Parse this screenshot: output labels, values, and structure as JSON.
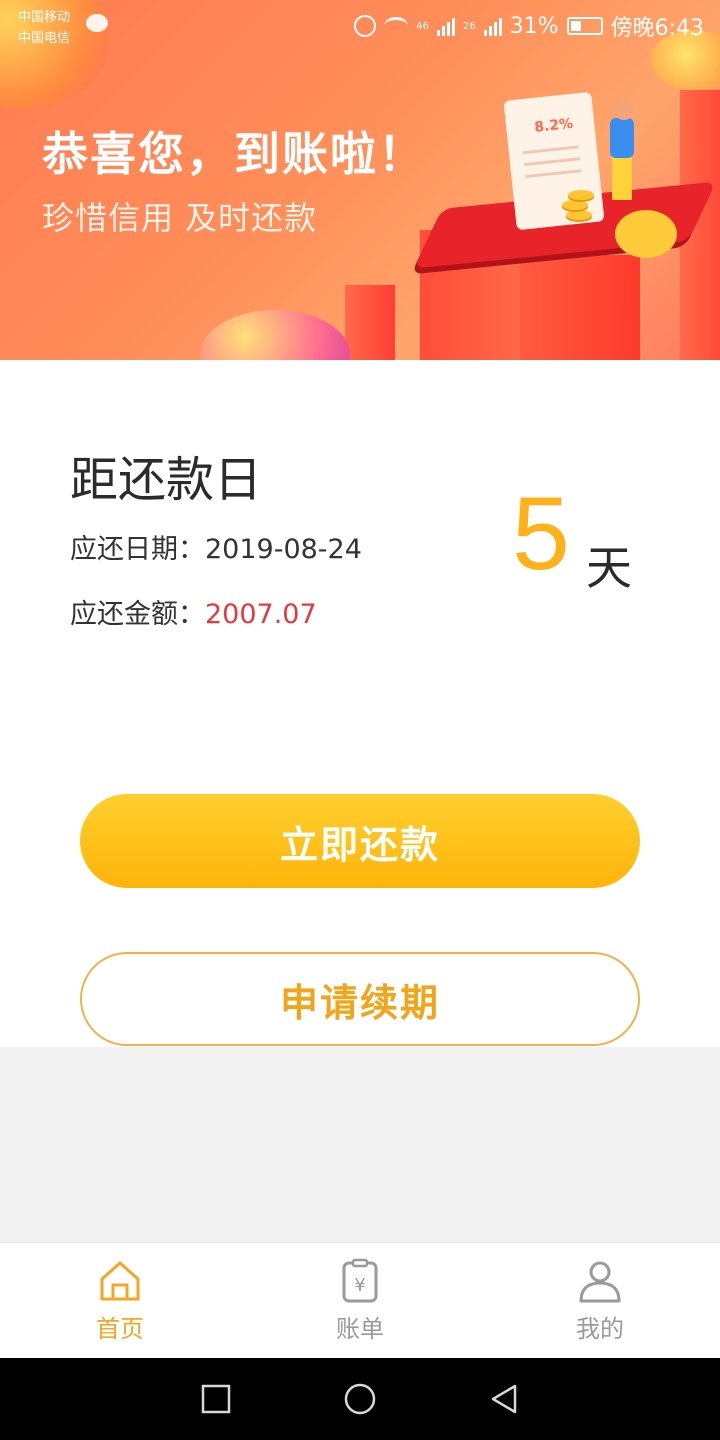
{
  "status_bar": {
    "carrier1": "中国移动",
    "carrier2": "中国电信",
    "network1": "46",
    "network2": "26",
    "battery": "31%",
    "time": "傍晚6:43"
  },
  "banner": {
    "title": "恭喜您，到账啦！",
    "subtitle": "珍惜信用 及时还款",
    "receipt_tag": "8.2%"
  },
  "due": {
    "title": "距还款日",
    "date_label": "应还日期：",
    "date_value": "2019-08-24",
    "amount_label": "应还金额：",
    "amount_value": "2007.07",
    "days_number": "5",
    "days_unit": "天"
  },
  "actions": {
    "repay_now": "立即还款",
    "apply_extension": "申请续期"
  },
  "tabs": [
    {
      "label": "首页",
      "icon": "home-icon",
      "active": true
    },
    {
      "label": "账单",
      "icon": "bill-icon",
      "active": false
    },
    {
      "label": "我的",
      "icon": "profile-icon",
      "active": false
    }
  ],
  "colors": {
    "accent": "#ffb11b",
    "amount": "#e8383d",
    "tab_active": "#f5a623",
    "banner": "#ff7a52"
  }
}
